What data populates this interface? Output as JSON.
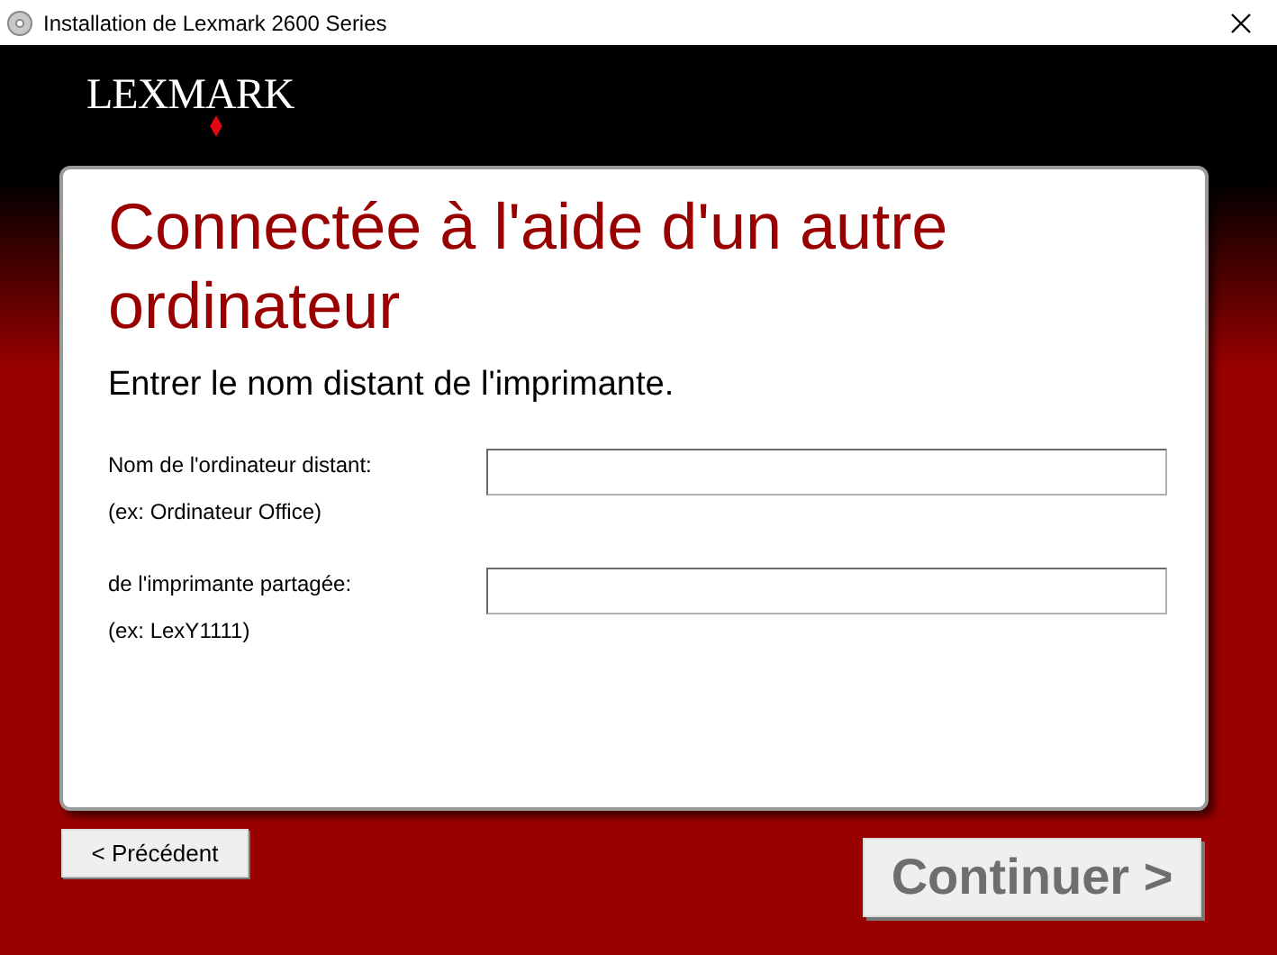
{
  "window": {
    "title": "Installation de Lexmark 2600 Series"
  },
  "logo": {
    "text": "LEXMARK"
  },
  "panel": {
    "title": "Connectée à l'aide d'un autre ordinateur",
    "subtitle": "Entrer le nom distant de l'imprimante.",
    "fields": [
      {
        "label": "Nom de l'ordinateur distant:",
        "hint": "(ex: Ordinateur Office)"
      },
      {
        "label": "de l'imprimante partagée:",
        "hint": "(ex: LexY1111)"
      }
    ]
  },
  "buttons": {
    "back": {
      "label": "< Précédent",
      "disabled": false
    },
    "next": {
      "label": "Continuer >",
      "disabled": true
    }
  }
}
